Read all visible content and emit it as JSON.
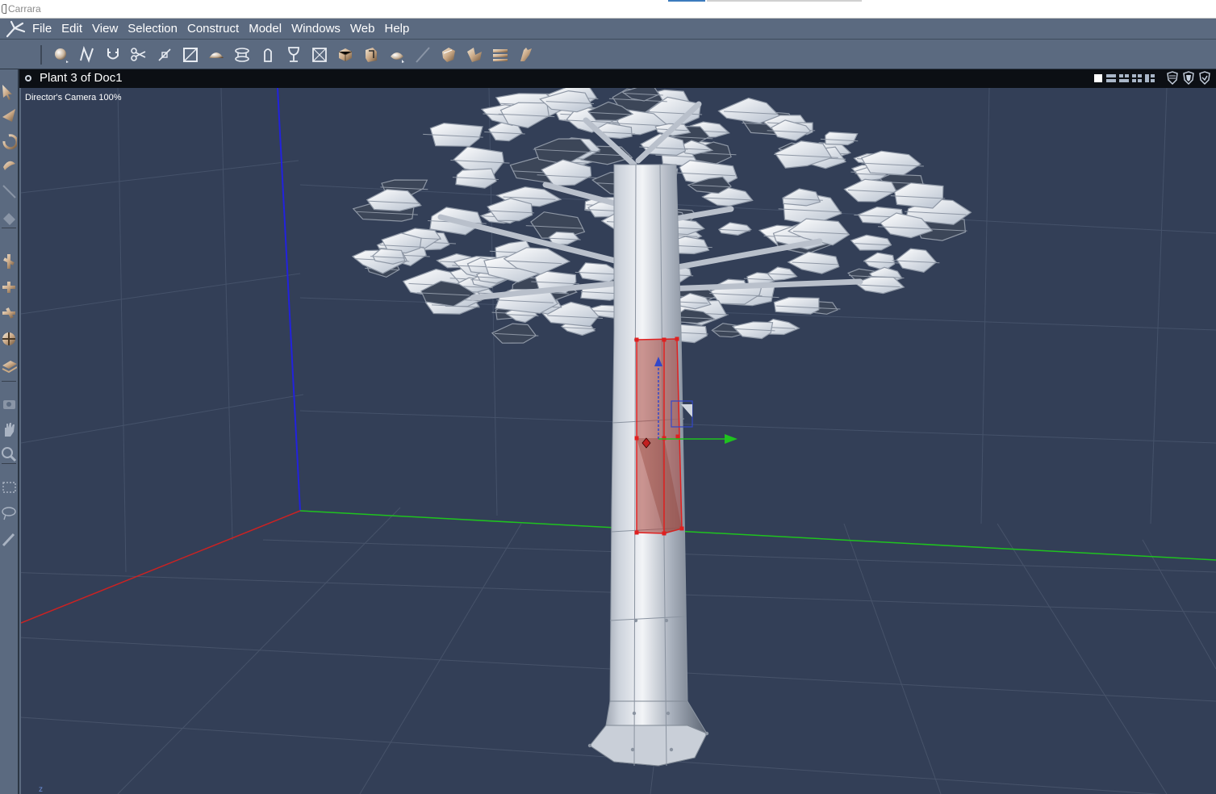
{
  "window": {
    "title": "Carrara"
  },
  "menubar": {
    "items": [
      "File",
      "Edit",
      "View",
      "Selection",
      "Construct",
      "Model",
      "Windows",
      "Web",
      "Help"
    ]
  },
  "toolbar": {
    "tools": [
      "sphere-tool",
      "spline-tool",
      "magnet-tool",
      "scissors-tool",
      "weld-tool",
      "scale-box-tool",
      "dome-tool",
      "lathe-tool",
      "extrude-tool",
      "goblet-tool",
      "box-select-tool",
      "cube-tool",
      "sweep-tool",
      "shading-tool",
      "line-tool",
      "smooth-tool",
      "fold-tool",
      "align-tool",
      "bend-tool"
    ]
  },
  "lefttools": {
    "tools": [
      "arrow-tool",
      "move-tool",
      "rotate-tool",
      "twist-tool",
      "pen-tool",
      "eraser-tool",
      "translate-x-tool",
      "translate-y-tool",
      "translate-z-tool",
      "universal-tool",
      "plane-tool",
      "camera-tool",
      "hand-tool",
      "zoom-tool",
      "marquee-tool",
      "lasso-tool",
      "brush-tool"
    ]
  },
  "document": {
    "title": "Plant 3 of Doc1",
    "camera_label": "Director's Camera 100%",
    "axis_indicator": "z"
  },
  "colors": {
    "background": "#333f57",
    "ui_panel": "#5b6a80",
    "doc_bar": "#0c0f14",
    "selection": "#e02020",
    "x_axis": "#cc2222",
    "y_axis": "#1fc21f",
    "z_axis": "#2222dd"
  }
}
